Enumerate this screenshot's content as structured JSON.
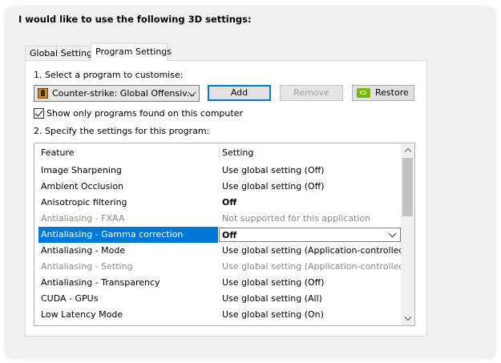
{
  "heading": "I would like to use the following 3D settings:",
  "tabs": [
    {
      "label": "Global Settings",
      "active": false
    },
    {
      "label": "Program Settings",
      "active": true
    }
  ],
  "step1_label": "1. Select a program to customise:",
  "program_select": {
    "value": "Counter-strike: Global Offensiv...",
    "icon": "csgo-icon"
  },
  "buttons": {
    "add": "Add",
    "remove": "Remove",
    "restore": "Restore"
  },
  "checkbox": {
    "label": "Show only programs found on this computer",
    "checked": true
  },
  "step2_label": "2. Specify the settings for this program:",
  "table": {
    "headers": {
      "feature": "Feature",
      "setting": "Setting"
    },
    "rows": [
      {
        "feature": "Image Sharpening",
        "setting": "Use global setting (Off)"
      },
      {
        "feature": "Ambient Occlusion",
        "setting": "Use global setting (Off)"
      },
      {
        "feature": "Anisotropic filtering",
        "setting": "Off"
      },
      {
        "feature": "Antialiasing - FXAA",
        "setting": "Not supported for this application"
      },
      {
        "feature": "Antialiasing - Gamma correction",
        "setting": "Off"
      },
      {
        "feature": "Antialiasing - Mode",
        "setting": "Use global setting (Application-controlled)"
      },
      {
        "feature": "Antialiasing - Setting",
        "setting": "Use global setting (Application-controlled)"
      },
      {
        "feature": "Antialiasing - Transparency",
        "setting": "Use global setting (Off)"
      },
      {
        "feature": "CUDA - GPUs",
        "setting": "Use global setting (All)"
      },
      {
        "feature": "Low Latency Mode",
        "setting": "Use global setting (On)"
      }
    ]
  },
  "colors": {
    "accent": "#0078d7",
    "nvidia": "#76b900",
    "disabled": "#8a8a8a"
  }
}
